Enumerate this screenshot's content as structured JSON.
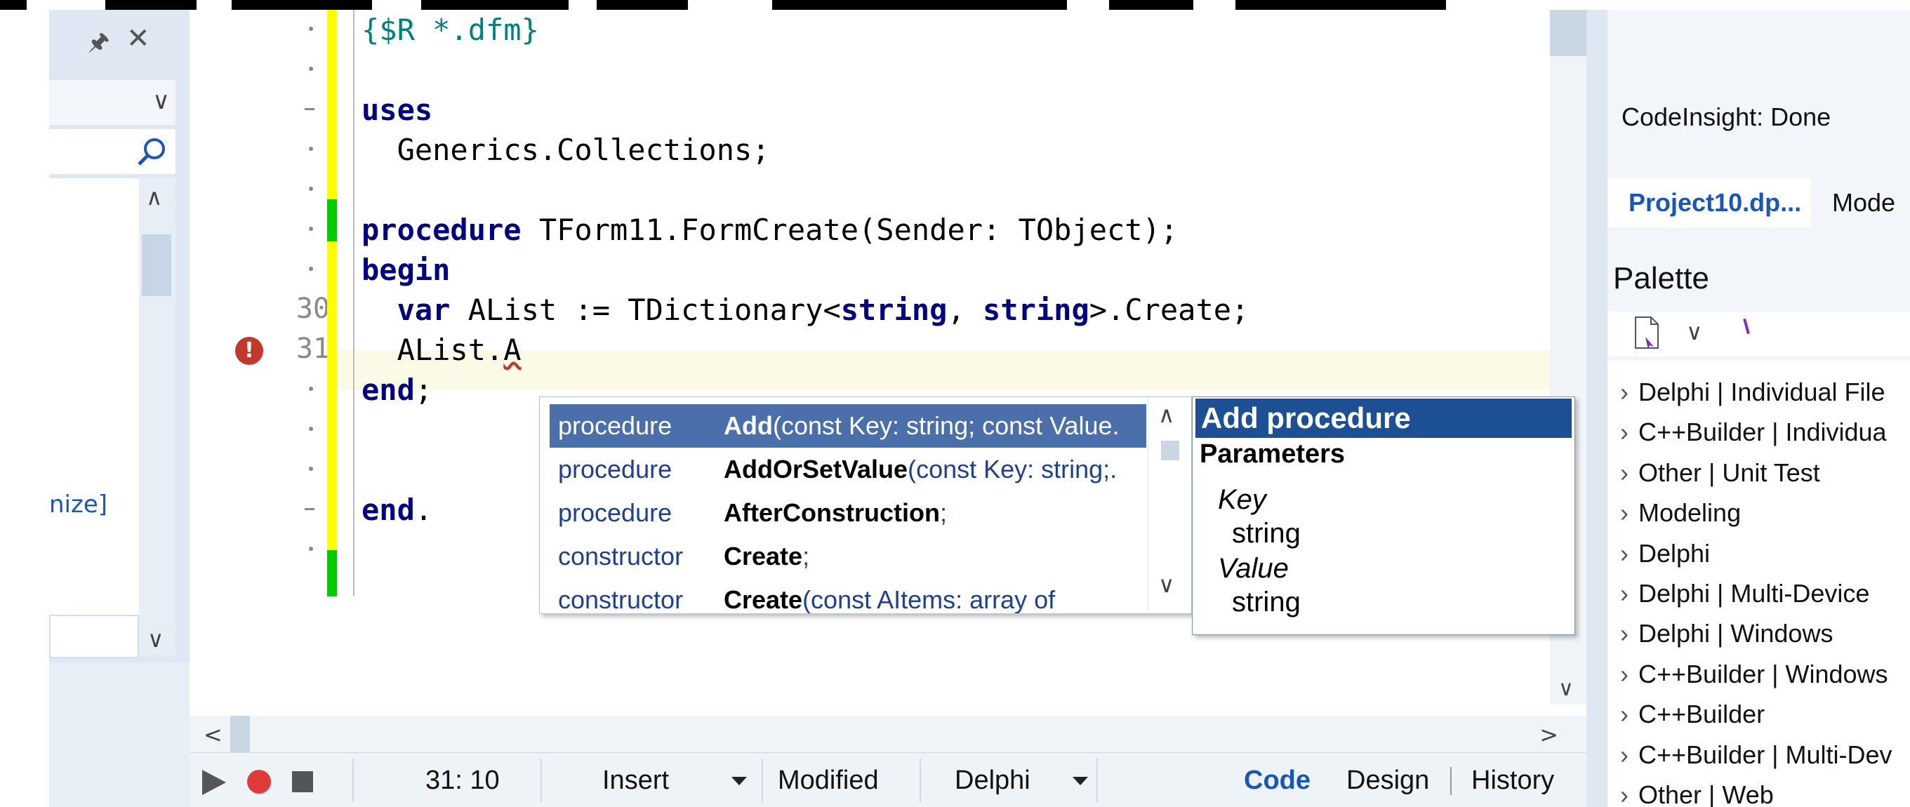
{
  "left_panel": {
    "label": "nize]"
  },
  "editor": {
    "gutter_numbers": [
      "30",
      "31"
    ],
    "lines": [
      {
        "segments": [
          {
            "t": "{$R *.dfm}",
            "c": "dir"
          }
        ]
      },
      {
        "segments": []
      },
      {
        "segments": [
          {
            "t": "uses",
            "c": "kw"
          }
        ]
      },
      {
        "segments": [
          {
            "t": "  Generics.Collections;",
            "c": ""
          }
        ]
      },
      {
        "segments": []
      },
      {
        "segments": [
          {
            "t": "procedure",
            "c": "kw"
          },
          {
            "t": " TForm11.FormCreate(Sender: TObject);",
            "c": ""
          }
        ]
      },
      {
        "segments": [
          {
            "t": "begin",
            "c": "kw"
          }
        ]
      },
      {
        "segments": [
          {
            "t": "  ",
            "c": ""
          },
          {
            "t": "var",
            "c": "kw"
          },
          {
            "t": " AList := TDictionary<",
            "c": ""
          },
          {
            "t": "string",
            "c": "kw"
          },
          {
            "t": ", ",
            "c": ""
          },
          {
            "t": "string",
            "c": "kw"
          },
          {
            "t": ">.Create;",
            "c": ""
          }
        ]
      },
      {
        "segments": [
          {
            "t": "  AList.A",
            "c": ""
          }
        ]
      },
      {
        "segments": [
          {
            "t": "end",
            "c": "kw"
          },
          {
            "t": ";",
            "c": ""
          }
        ]
      },
      {
        "segments": []
      },
      {
        "segments": []
      },
      {
        "segments": [
          {
            "t": "end",
            "c": "kw"
          },
          {
            "t": ".",
            "c": ""
          }
        ]
      },
      {
        "segments": []
      }
    ]
  },
  "completion": {
    "items": [
      {
        "kind": "procedure",
        "name": "Add",
        "params": "(const Key: string; const Value.",
        "selected": true
      },
      {
        "kind": "procedure",
        "name": "AddOrSetValue",
        "params": "(const Key: string;.",
        "selected": false
      },
      {
        "kind": "procedure",
        "name": "AfterConstruction",
        "params": ";",
        "selected": false
      },
      {
        "kind": "constructor",
        "name": "Create",
        "params": ";",
        "selected": false
      },
      {
        "kind": "constructor",
        "name": "Create",
        "params": "(const AItems: array of",
        "selected": false
      }
    ]
  },
  "hint": {
    "title": "Add procedure",
    "subtitle": "Parameters",
    "params": [
      {
        "name": "Key",
        "type": "string"
      },
      {
        "name": "Value",
        "type": "string"
      }
    ]
  },
  "statusbar": {
    "position": "31: 10",
    "mode": "Insert",
    "state": "Modified",
    "language": "Delphi",
    "tabs": [
      "Code",
      "Design",
      "History"
    ]
  },
  "right_panel": {
    "status": "CodeInsight: Done",
    "project_tab": "Project10.dp...",
    "second_tab": "Mode",
    "palette_title": "Palette",
    "palette_items": [
      "Delphi | Individual File",
      "C++Builder | Individua",
      "Other | Unit Test",
      "Modeling",
      "Delphi",
      "Delphi | Multi-Device",
      "Delphi | Windows",
      "C++Builder | Windows",
      "C++Builder",
      "C++Builder | Multi-Dev",
      "Other | Web"
    ]
  },
  "colors": {
    "keyword": "#000080",
    "directive": "#008080",
    "change_saved": "#00cc00",
    "change_unsaved": "#ffff00",
    "selection": "#4a6fab",
    "hint_title": "#1d4f94",
    "error": "#c0392b"
  },
  "icons": [
    "pin-icon",
    "close-icon",
    "search-icon",
    "error-icon",
    "play-icon",
    "record-icon",
    "stop-icon",
    "new-item-icon"
  ]
}
